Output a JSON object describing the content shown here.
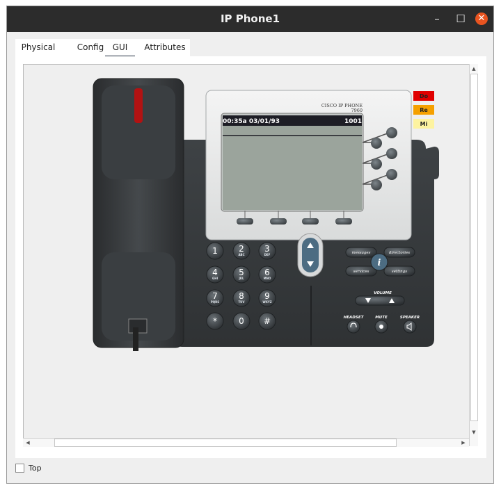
{
  "window": {
    "title": "IP Phone1",
    "minimize": "–",
    "maximize": "☐",
    "close": "✕"
  },
  "tabs": [
    {
      "label": "Physical",
      "active": false
    },
    {
      "label": "Config",
      "active": false
    },
    {
      "label": "GUI",
      "active": true
    },
    {
      "label": "Attributes",
      "active": false
    }
  ],
  "phone": {
    "brand_line1": "CISCO IP PHONE",
    "brand_line2": "7960",
    "screen_time": "00:35a 03/01/93",
    "screen_extension": "1001",
    "indicators": [
      {
        "label": "Do",
        "color": "#e00000"
      },
      {
        "label": "Re",
        "color": "#f5a000"
      },
      {
        "label": "Mi",
        "color": "#fdf3a0"
      }
    ],
    "keypad": [
      {
        "main": "1",
        "sub": ""
      },
      {
        "main": "2",
        "sub": "ABC"
      },
      {
        "main": "3",
        "sub": "DEF"
      },
      {
        "main": "4",
        "sub": "GHI"
      },
      {
        "main": "5",
        "sub": "JKL"
      },
      {
        "main": "6",
        "sub": "MNO"
      },
      {
        "main": "7",
        "sub": "PQRS"
      },
      {
        "main": "8",
        "sub": "TUV"
      },
      {
        "main": "9",
        "sub": "WXYZ"
      },
      {
        "main": "*",
        "sub": ""
      },
      {
        "main": "0",
        "sub": ""
      },
      {
        "main": "#",
        "sub": ""
      }
    ],
    "function_keys": {
      "messages": "messages",
      "directories": "directories",
      "services": "services",
      "settings": "settings",
      "info": "i"
    },
    "volume_label": "VOLUME",
    "headset_label": "HEADSET",
    "mute_label": "MUTE",
    "speaker_label": "SPEAKER"
  },
  "footer": {
    "top_label": "Top",
    "top_checked": false
  },
  "colors": {
    "titlebar": "#2c2c2c",
    "close_button": "#e95420",
    "lcd": "#9ba49c",
    "lcd_header": "#1d1d25",
    "phone_body": "#3a3d40"
  }
}
